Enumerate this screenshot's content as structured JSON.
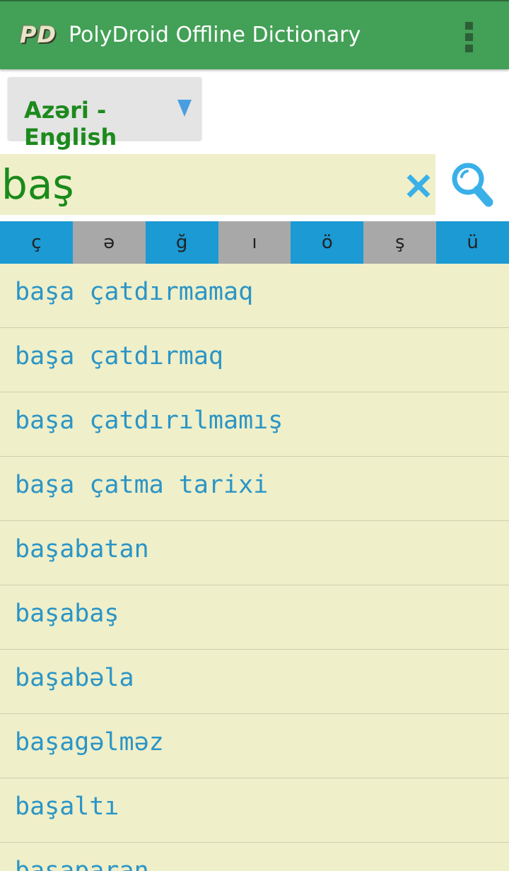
{
  "app_bar": {
    "logo": "PD",
    "title": "PolyDroid Offline Dictionary",
    "menu_icon": "overflow-menu-icon"
  },
  "language_selector": {
    "label": "Azəri - English",
    "arrow_icon": "dropdown-triangle-icon",
    "arrow_color": "#4a9ee0"
  },
  "search": {
    "value": "baş",
    "clear_icon": "close-x-icon",
    "search_icon": "magnifier-icon",
    "icon_color": "#3ab0e8"
  },
  "special_chars": [
    "ç",
    "ə",
    "ğ",
    "ı",
    "ö",
    "ş",
    "ü"
  ],
  "results": [
    "başa çatdırmamaq",
    "başa çatdırmaq",
    "başa çatdırılmamış",
    "başa çatma tarixi",
    "başabatan",
    "başabaş",
    "başabəla",
    "başagəlməz",
    "başaltı",
    "başaparan"
  ],
  "colors": {
    "app_bar": "#43a057",
    "list_bg": "#efefc9",
    "result_text": "#2b95c6",
    "search_text": "#1a8a1a"
  }
}
